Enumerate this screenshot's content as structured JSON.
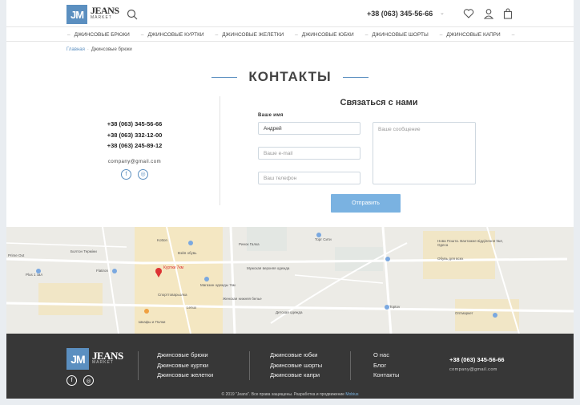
{
  "header": {
    "logo_mark": "JM",
    "logo_name": "JEANS",
    "logo_sub": "MARKET",
    "phone": "+38 (063) 345-56-66"
  },
  "nav": {
    "items": [
      "ДЖИНСОВЫЕ БРЮКИ",
      "ДЖИНСОВЫЕ КУРТКИ",
      "ДЖИНСОВЫЕ ЖЕЛЕТКИ",
      "ДЖИНСОВЫЕ ЮБКИ",
      "ДЖИНСОВЫЕ ШОРТЫ",
      "ДЖИНСОВЫЕ КАПРИ"
    ]
  },
  "breadcrumb": {
    "home": "Главная",
    "current": "Джинсовые брюки"
  },
  "page_title": "КОНТАКТЫ",
  "contacts": {
    "phones": [
      "+38 (063) 345-56-66",
      "+38 (063) 332-12-00",
      "+38 (063) 245-89-12"
    ],
    "email": "company@gmail.com"
  },
  "form": {
    "title": "Связаться с нами",
    "name_label": "Ваше имя",
    "name_value": "Андрей",
    "email_placeholder": "Ваше e-mail",
    "phone_placeholder": "Ваш телефон",
    "message_placeholder": "Ваше сообщение",
    "submit_label": "Отправить"
  },
  "map": {
    "marker_label": "Куртки 7км",
    "places": [
      "Prime Out",
      "Kotton",
      "Ринок Галка",
      "Торг Сити",
      "Нова Пошта. Вантажне відділення №2, Одеса",
      "Обувь для всех",
      "Болтон Терміни",
      "Flatiron",
      "Plus 1 зал",
      "Мужская верхняя одежда",
      "Вэйя обувь",
      "Магазин одежды 7км",
      "Спорттоварьолка",
      "Женская нижняя белье",
      "Lenux",
      "Детская одежда",
      "Toptov",
      "Oптмаркет",
      "Шкафы и Полки"
    ]
  },
  "footer": {
    "col1": [
      "Джинсовые брюки",
      "Джинсовые куртки",
      "Джинсовые желетки"
    ],
    "col2": [
      "Джинсовые юбки",
      "Джинсовые шорты",
      "Джинсовые капри"
    ],
    "col3": [
      "О нас",
      "Блог",
      "Контакты"
    ],
    "phone": "+38 (063) 345-56-66",
    "email": "company@gmail.com",
    "copyright": "© 2019 \"Jeans\". Все права защищены. Разработка и продвижение",
    "developer": "Mobius"
  },
  "colors": {
    "accent": "#5b8fc0",
    "button": "#7ab2e1",
    "footer_bg": "#373737"
  }
}
